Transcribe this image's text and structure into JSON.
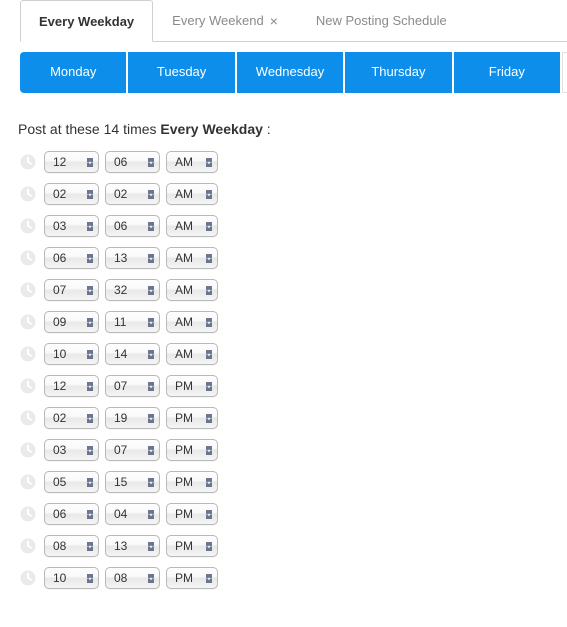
{
  "tabs": [
    {
      "label": "Every Weekday",
      "closable": false,
      "active": true
    },
    {
      "label": "Every Weekend",
      "closable": true,
      "active": false
    },
    {
      "label": "New Posting Schedule",
      "closable": false,
      "active": false
    }
  ],
  "days": [
    "Monday",
    "Tuesday",
    "Wednesday",
    "Thursday",
    "Friday"
  ],
  "heading": {
    "prefix": "Post at these ",
    "count": "14",
    "mid": " times ",
    "schedule_name": "Every Weekday",
    "suffix": " :"
  },
  "times": [
    {
      "hour": "12",
      "minute": "06",
      "ampm": "AM"
    },
    {
      "hour": "02",
      "minute": "02",
      "ampm": "AM"
    },
    {
      "hour": "03",
      "minute": "06",
      "ampm": "AM"
    },
    {
      "hour": "06",
      "minute": "13",
      "ampm": "AM"
    },
    {
      "hour": "07",
      "minute": "32",
      "ampm": "AM"
    },
    {
      "hour": "09",
      "minute": "11",
      "ampm": "AM"
    },
    {
      "hour": "10",
      "minute": "14",
      "ampm": "AM"
    },
    {
      "hour": "12",
      "minute": "07",
      "ampm": "PM"
    },
    {
      "hour": "02",
      "minute": "19",
      "ampm": "PM"
    },
    {
      "hour": "03",
      "minute": "07",
      "ampm": "PM"
    },
    {
      "hour": "05",
      "minute": "15",
      "ampm": "PM"
    },
    {
      "hour": "06",
      "minute": "04",
      "ampm": "PM"
    },
    {
      "hour": "08",
      "minute": "13",
      "ampm": "PM"
    },
    {
      "hour": "10",
      "minute": "08",
      "ampm": "PM"
    }
  ]
}
